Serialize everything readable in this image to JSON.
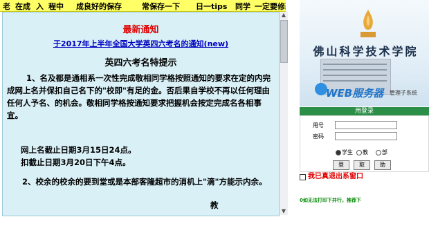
{
  "ticker": {
    "items": [
      "老",
      "在成",
      "入",
      "程中",
      "成良好的保存",
      "常保存一下",
      "日一tips",
      "同学",
      "一定要修改原"
    ]
  },
  "notice": {
    "title": "最新通知",
    "link": "于2017年上半年全国大学英四六考名的通知(new)",
    "heading": "英四六考名特提示",
    "paragraph1": "1、名及都是通相系一次性完成敬相同学格按照通知的要求在定的内完成网上名并保扣自己名下的\"校即\"有足的金。否后果自学校不再以任何理由任何人予名、的机会。敬相同学格按通知要求把握机会按定完成名各相事宜。",
    "deadline1": "网上名截止日期3月15日24点。",
    "deadline2": "扣截止日期3月20日下午4点。",
    "paragraph2": "2、校余的校余的要到堂或是本部客隆超市的消机上\"滴\"方能示内余。",
    "signature": "教"
  },
  "scrollbar": {
    "up": "▲",
    "down": "▼"
  },
  "banner": {
    "school_name": "佛山科学技术学院",
    "web_label": "WEB服务器",
    "manager_label": "管理子系统"
  },
  "login": {
    "header": "用登录",
    "username_label": "用号",
    "password_label": "密码",
    "roles": [
      {
        "label": "学生",
        "selected": true
      },
      {
        "label": "教",
        "selected": false
      },
      {
        "label": "部",
        "selected": false
      }
    ],
    "buttons": [
      "登",
      "取",
      "助"
    ]
  },
  "exit_note": "我已真退出系窗口",
  "footer_tip": "0如无法打印下并行，推荐下"
}
